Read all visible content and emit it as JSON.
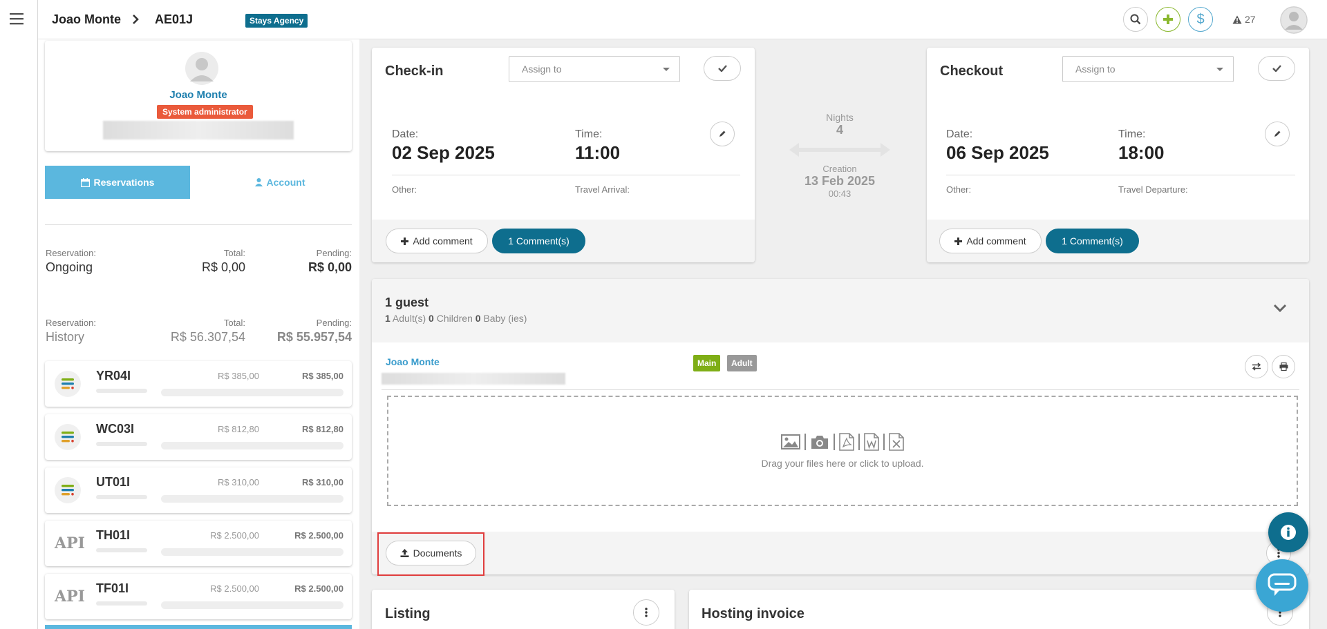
{
  "header": {
    "crumb_name": "Joao Monte",
    "crumb_code": "AE01J",
    "agency_badge": "Stays Agency",
    "dollar_label": "$",
    "alerts_count": "27"
  },
  "profile": {
    "name": "Joao Monte",
    "role": "System administrator"
  },
  "sidebar_tabs": {
    "reservations": "Reservations",
    "account": "Account"
  },
  "ongoing": {
    "reservation_label": "Reservation:",
    "status": "Ongoing",
    "total_label": "Total:",
    "total": "R$ 0,00",
    "pending_label": "Pending:",
    "pending": "R$ 0,00"
  },
  "history": {
    "reservation_label": "Reservation:",
    "status": "History",
    "total_label": "Total:",
    "total": "R$ 56.307,54",
    "pending_label": "Pending:",
    "pending": "R$ 55.957,54"
  },
  "reservations": [
    {
      "code": "YR04I",
      "total": "R$ 385,00",
      "pending": "R$ 385,00",
      "icon": "stack-icon"
    },
    {
      "code": "WC03I",
      "total": "R$ 812,80",
      "pending": "R$ 812,80",
      "icon": "stack-icon"
    },
    {
      "code": "UT01I",
      "total": "R$ 310,00",
      "pending": "R$ 310,00",
      "icon": "stack-icon"
    },
    {
      "code": "TH01I",
      "total": "R$ 2.500,00",
      "pending": "R$ 2.500,00",
      "icon": "api-icon"
    },
    {
      "code": "TF01I",
      "total": "R$ 2.500,00",
      "pending": "R$ 2.500,00",
      "icon": "api-icon"
    }
  ],
  "api_text": "API",
  "checkin": {
    "title": "Check-in",
    "assign_placeholder": "Assign to",
    "date_label": "Date:",
    "date": "02 Sep 2025",
    "time_label": "Time:",
    "time": "11:00",
    "other_label": "Other:",
    "travel_label": "Travel Arrival:",
    "add_comment": "Add comment",
    "comments": "1 Comment(s)"
  },
  "checkout": {
    "title": "Checkout",
    "assign_placeholder": "Assign to",
    "date_label": "Date:",
    "date": "06 Sep 2025",
    "time_label": "Time:",
    "time": "18:00",
    "other_label": "Other:",
    "travel_label": "Travel Departure:",
    "add_comment": "Add comment",
    "comments": "1 Comment(s)"
  },
  "stay": {
    "nights_label": "Nights",
    "nights": "4",
    "creation_label": "Creation",
    "creation_date": "13 Feb 2025",
    "creation_time": "00:43"
  },
  "guests": {
    "title": "1 guest",
    "adults": "1",
    "adults_label": "Adult(s)",
    "children": "0",
    "children_label": "Children",
    "babies": "0",
    "babies_label": "Baby (ies)",
    "guest_name": "Joao Monte",
    "badge_main": "Main",
    "badge_adult": "Adult",
    "upload_text": "Drag your files here or click to upload.",
    "documents_button": "Documents"
  },
  "listing": {
    "title": "Listing"
  },
  "invoice": {
    "title": "Hosting invoice"
  },
  "colors": {
    "accent": "#5bb7de",
    "dark_teal": "#0e6e8e",
    "role_badge": "#ea5a3b",
    "main_badge": "#7fae16",
    "adult_badge": "#999999",
    "highlight_box": "#e03c3c"
  }
}
